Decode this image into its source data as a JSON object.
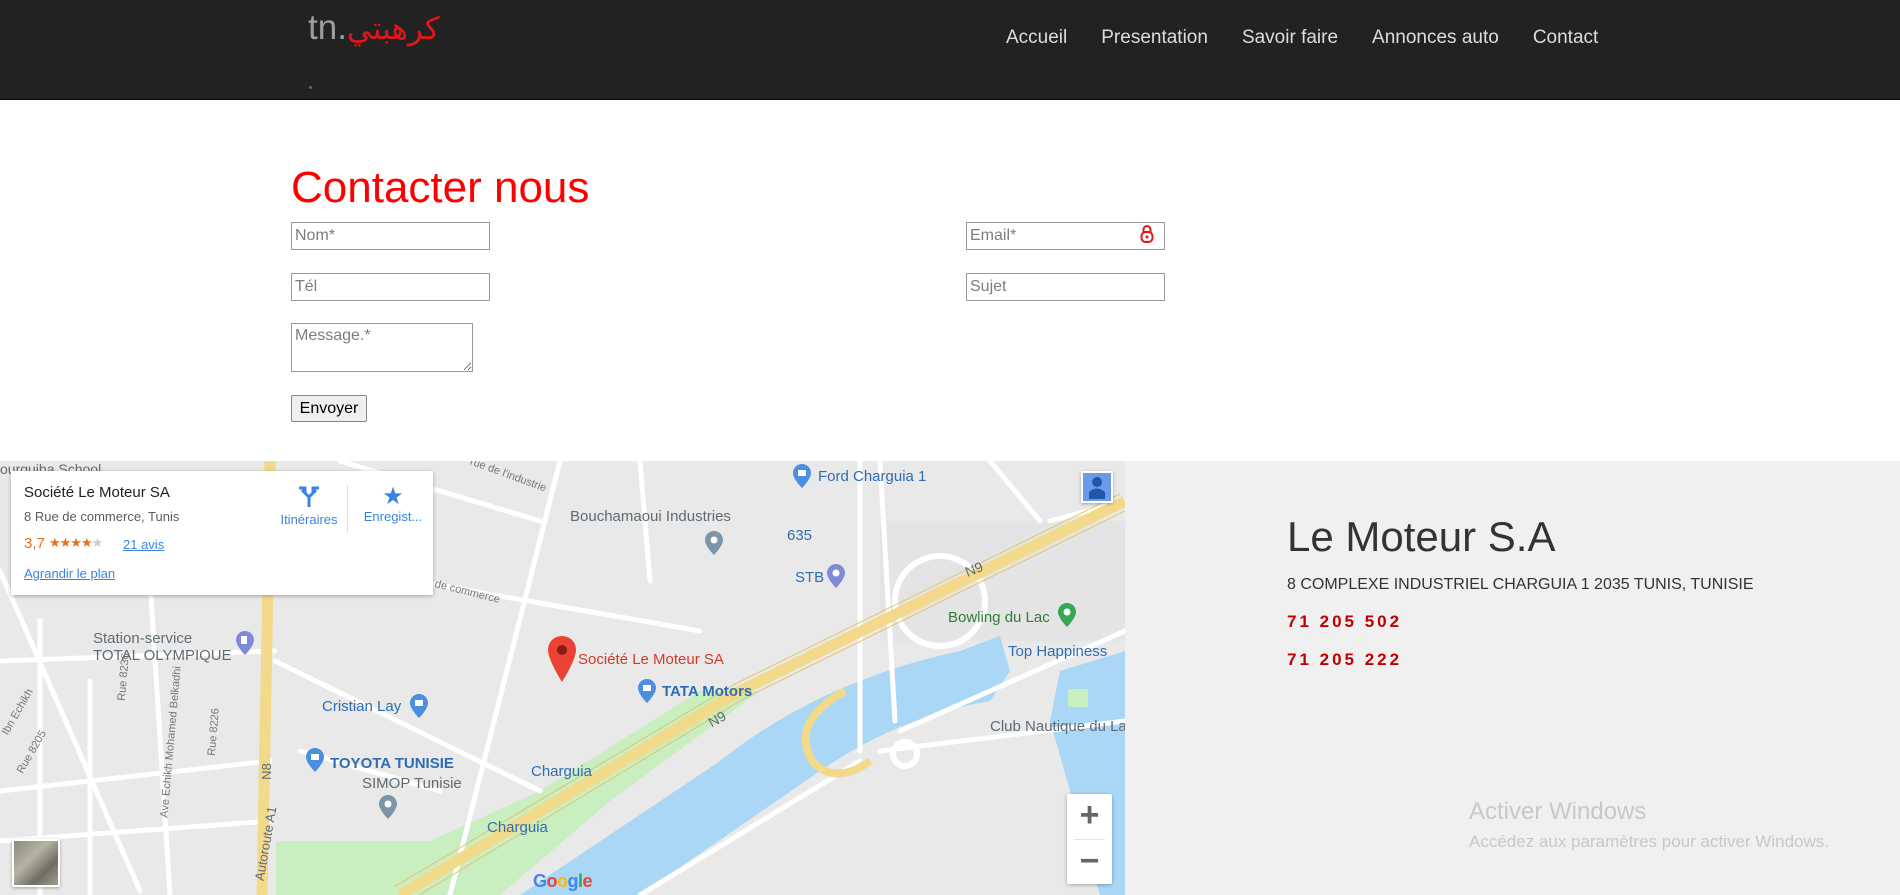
{
  "header": {
    "brand_latin": "tn.",
    "brand_arabic": "كرهبتي",
    "nav": [
      {
        "label": "Accueil"
      },
      {
        "label": "Presentation"
      },
      {
        "label": "Savoir faire"
      },
      {
        "label": "Annonces auto"
      },
      {
        "label": "Contact"
      }
    ]
  },
  "contact": {
    "title": "Contacter nous",
    "fields": {
      "nom": {
        "placeholder": "Nom*",
        "value": ""
      },
      "email": {
        "placeholder": "Email*",
        "value": ""
      },
      "tel": {
        "placeholder": "Tél",
        "value": ""
      },
      "sujet": {
        "placeholder": "Sujet",
        "value": ""
      },
      "message": {
        "placeholder": "Message.*",
        "value": ""
      }
    },
    "submit_label": "Envoyer"
  },
  "map": {
    "card": {
      "name": "Société Le Moteur SA",
      "address": "8 Rue de commerce, Tunis",
      "rating": "3,7",
      "rating_stars": 3.7,
      "reviews": "21 avis",
      "enlarge": "Agrandir le plan",
      "directions": "Itinéraires",
      "save": "Enregist..."
    },
    "places": {
      "ford": "Ford Charguia 1",
      "bouchamaoui": "Bouchamaoui Industries",
      "n635": "635",
      "stb": "STB",
      "bowling": "Bowling du Lac",
      "top_happiness": "Top Happiness",
      "le_moteur": "Société Le Moteur SA",
      "tata": "TATA Motors",
      "total": "Station-service\nTOTAL OLYMPIQUE",
      "total_l1": "Station-service",
      "total_l2": "TOTAL OLYMPIQUE",
      "cristian": "Cristian Lay",
      "toyota": "TOYOTA TUNISIE",
      "simop": "SIMOP Tunisie",
      "charguia1": "Charguia",
      "charguia2": "Charguia",
      "club": "Club Nautique du La",
      "school": "ourguiba School",
      "n9a": "N9",
      "n9b": "N9",
      "n8": "N8",
      "autoroute": "Autoroute A1",
      "rue_industrie": "rue de l'industrie",
      "rue_commerce": "de commerce",
      "rue_8236": "Rue 8236",
      "rue_8226": "Rue 8226",
      "rue_8205": "Rue 8205",
      "ave_belkadhi": "Ave Echikh Mohamed Belkadhi",
      "echikh": "Ibn Echikh"
    },
    "zoom_in": "+",
    "zoom_out": "−",
    "google": "Google"
  },
  "company": {
    "name": "Le Moteur S.A",
    "address": "8 COMPLEXE INDUSTRIEL CHARGUIA 1 2035 TUNIS, TUNISIE",
    "phones": [
      "71 205 502",
      "71 205 222"
    ]
  },
  "watermark": {
    "title": "Activer Windows",
    "subtitle": "Accédez aux paramètres pour activer Windows."
  },
  "colors": {
    "header_bg": "#222222",
    "accent_red": "#ff0000",
    "phone_red": "#c00000",
    "panel_bg": "#f0f0f0"
  }
}
